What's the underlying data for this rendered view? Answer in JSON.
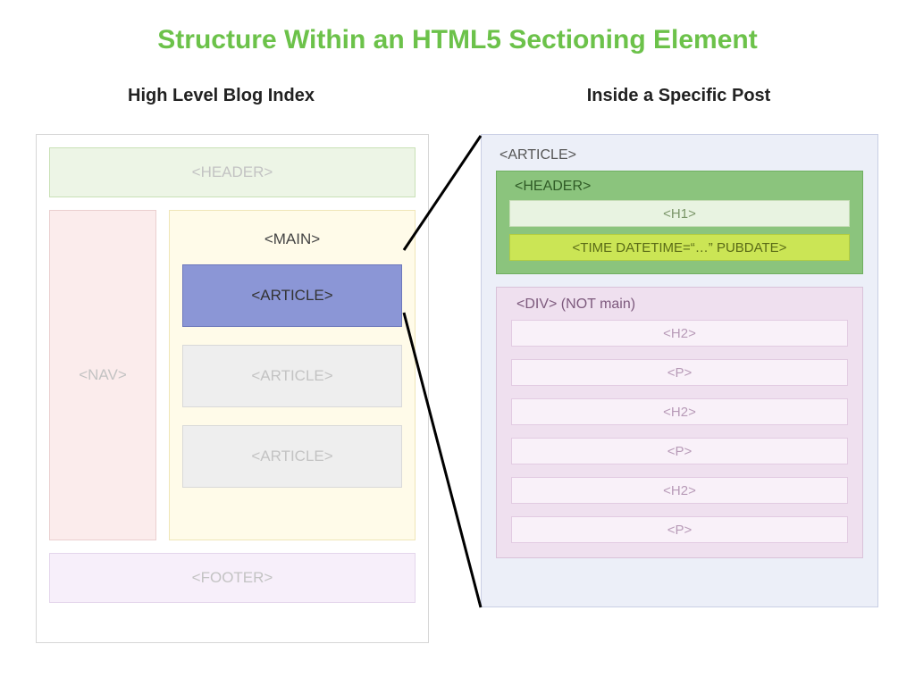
{
  "title": "Structure Within an HTML5 Sectioning Element",
  "left": {
    "subtitle": "High Level Blog Index",
    "header": "<HEADER>",
    "nav": "<NAV>",
    "main": "<MAIN>",
    "articles": [
      "<ARTICLE>",
      "<ARTICLE>",
      "<ARTICLE>"
    ],
    "footer": "<FOOTER>"
  },
  "right": {
    "subtitle": "Inside a Specific Post",
    "article": "<ARTICLE>",
    "header": "<HEADER>",
    "h1": "<H1>",
    "time": "<TIME DATETIME=“…” PUBDATE>",
    "div": "<DIV> (NOT main)",
    "content": [
      "<H2>",
      "<P>",
      "<H2>",
      "<P>",
      "<H2>",
      "<P>"
    ]
  }
}
